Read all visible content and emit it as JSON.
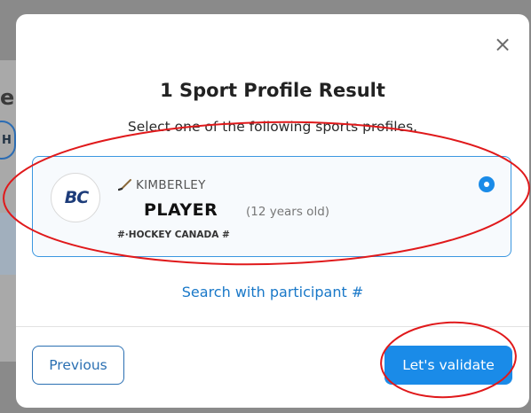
{
  "background": {
    "fragment_text": "e",
    "fragment_letter": "H"
  },
  "modal": {
    "close_glyph": "×",
    "title": "1 Sport Profile Result",
    "subtitle": "Select one of the following sports profiles.",
    "profile": {
      "logo_text": "BC",
      "club_name": "KIMBERLEY",
      "role": "PLAYER",
      "age": "(12 years old)",
      "organization": "#·HOCKEY CANADA #",
      "icon": "hockey-stick-icon",
      "selected": true
    },
    "search_link": "Search with participant #",
    "buttons": {
      "previous": "Previous",
      "validate": "Let's validate"
    }
  },
  "colors": {
    "accent": "#1a8be8",
    "link": "#1978c8",
    "annotation": "#e0191b"
  }
}
